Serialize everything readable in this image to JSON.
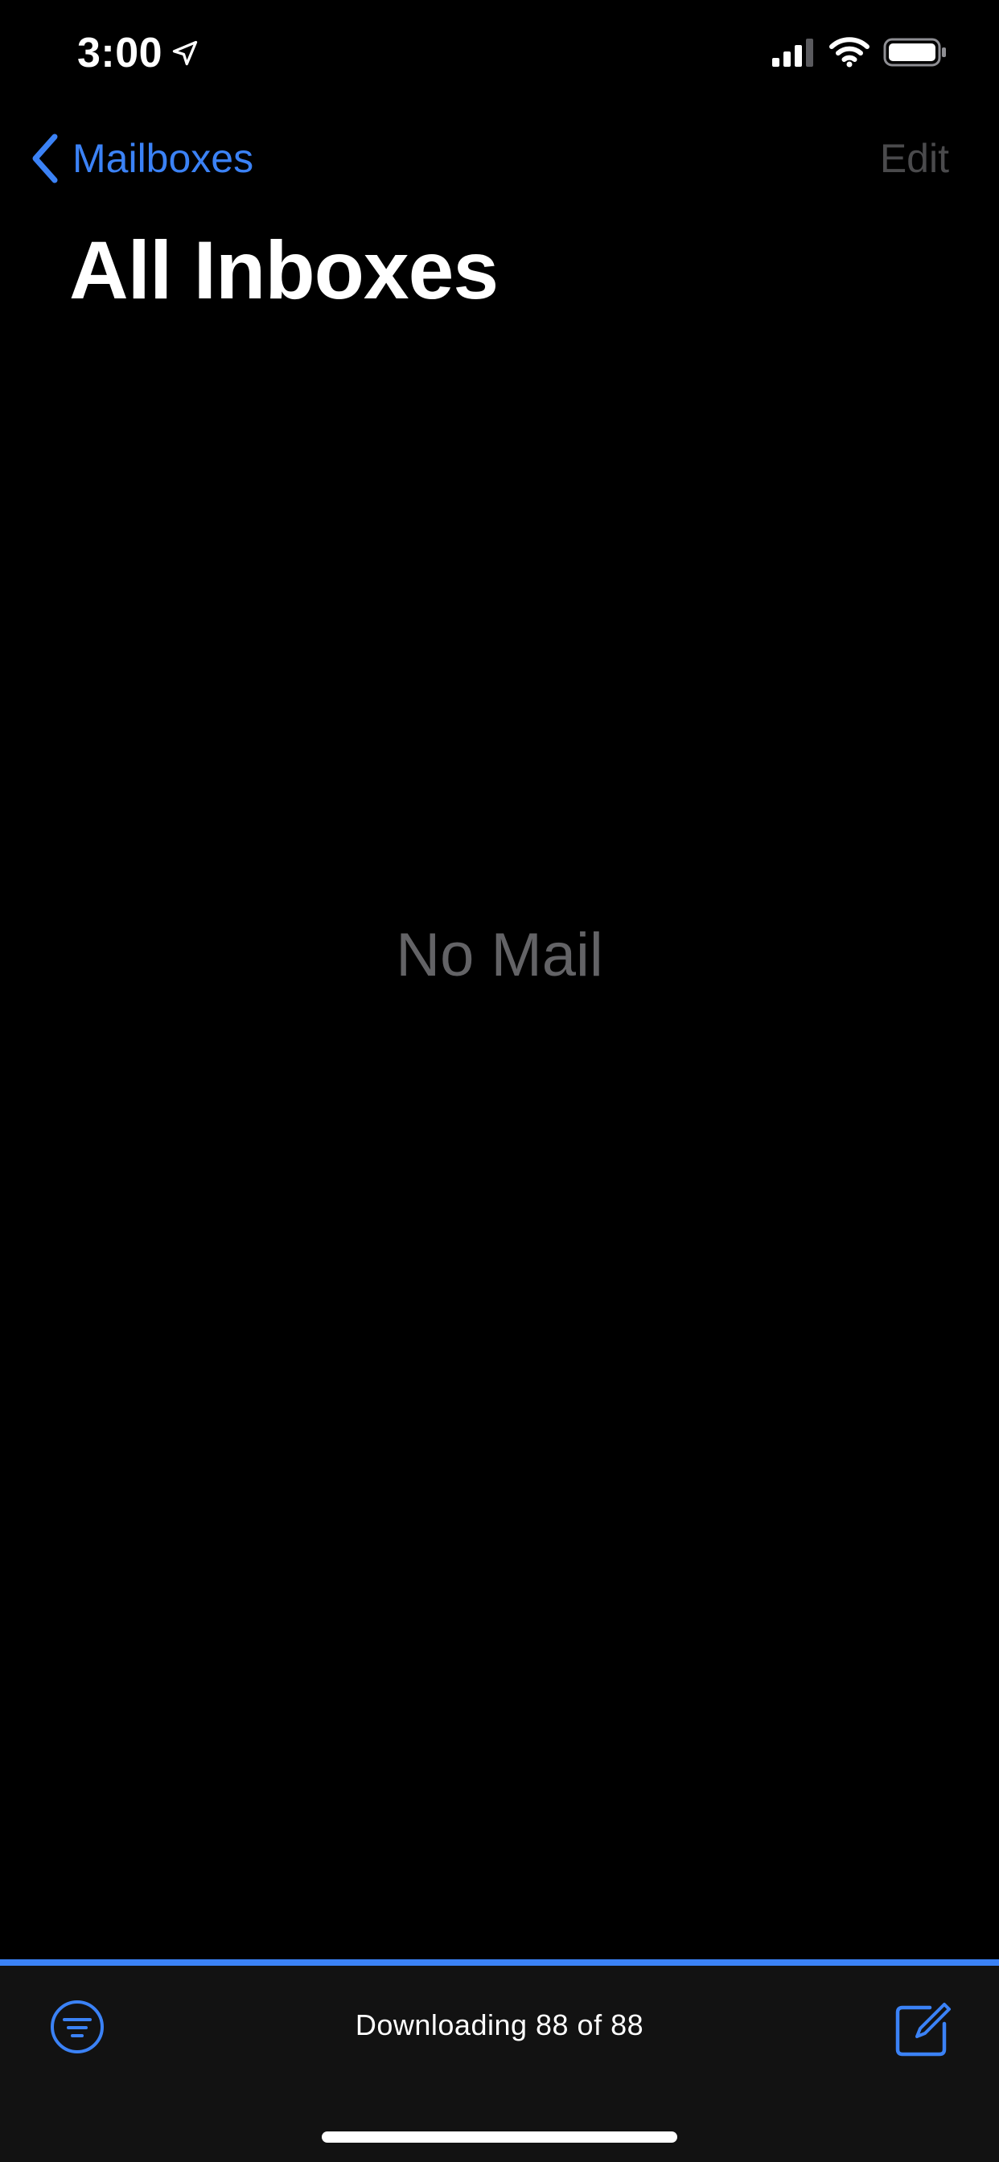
{
  "status_bar": {
    "time": "3:00",
    "icons": [
      "location-arrow-icon",
      "cellular-signal-icon",
      "wifi-icon",
      "battery-icon"
    ]
  },
  "nav": {
    "back_label": "Mailboxes",
    "back_icon": "chevron-left-icon",
    "edit_label": "Edit"
  },
  "page": {
    "title": "All Inboxes",
    "empty_message": "No Mail"
  },
  "toolbar": {
    "status": "Downloading 88 of 88",
    "progress_fraction": 1.0,
    "filter_icon": "filter-icon",
    "compose_icon": "compose-icon"
  },
  "colors": {
    "accent": "#3b82f6",
    "background": "#000000",
    "toolbar_background": "#121212",
    "empty_text": "#636366",
    "disabled_text": "#4a4a4c"
  }
}
